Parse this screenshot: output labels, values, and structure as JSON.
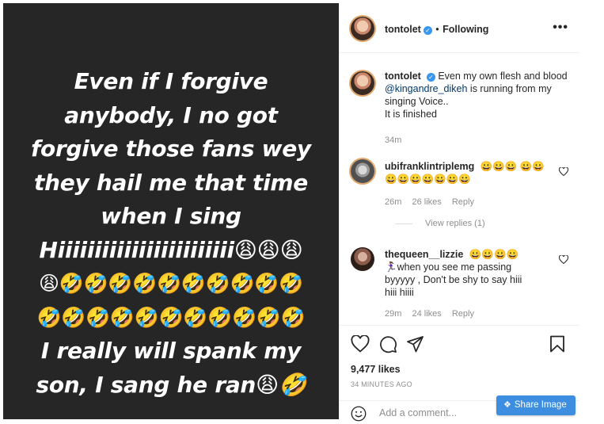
{
  "post": {
    "lines": [
      "Even if I forgive",
      "anybody, I no got",
      "forgive those fans wey",
      "they hail me that time",
      "when I sing",
      "Hiiiiiiiiiiiiiiiiiiiiiiii😩😩😩",
      "😩🤣🤣🤣🤣🤣🤣🤣🤣🤣🤣",
      "🤣🤣🤣🤣🤣🤣🤣🤣🤣🤣🤣",
      "I really will spank my",
      "son, I sang he ran😩🤣"
    ]
  },
  "header": {
    "username": "tontolet",
    "separator": "•",
    "follow_label": "Following",
    "more_label": "•••"
  },
  "caption": {
    "username": "tontolet",
    "text_before": "Even my own flesh and blood",
    "mention": "@kingandre_dikeh",
    "text_after": "is running from my singing Voice..",
    "line2": "It is finished",
    "time": "34m"
  },
  "comments": [
    {
      "username": "ubifranklintriplemg",
      "text": "😀😀😀 😀😀😀😀😀😀😀😀😀",
      "time": "26m",
      "likes": "26 likes",
      "reply": "Reply"
    },
    {
      "username": "thequeen__lizzie",
      "text": "😀😀😀😀 🏃🏽‍♀️when you see me passing byyyyy , Don't be shy to say hiii hiii hiiii",
      "time": "29m",
      "likes": "24 likes",
      "reply": "Reply"
    }
  ],
  "view_replies": "View replies (1)",
  "actions": {
    "likes": "9,477 likes",
    "time_ago": "34 MINUTES AGO",
    "comment_placeholder": "Add a comment..."
  },
  "share_button": {
    "label": "Share Image",
    "color": "#3d8ee0"
  },
  "icons": [
    "heart-icon",
    "comment-icon",
    "share-icon",
    "bookmark-icon",
    "smiley-icon",
    "verified-icon",
    "more-icon"
  ],
  "colors": {
    "post_bg": "#262626",
    "verified": "#3897f0",
    "muted": "#8e8e8e"
  }
}
